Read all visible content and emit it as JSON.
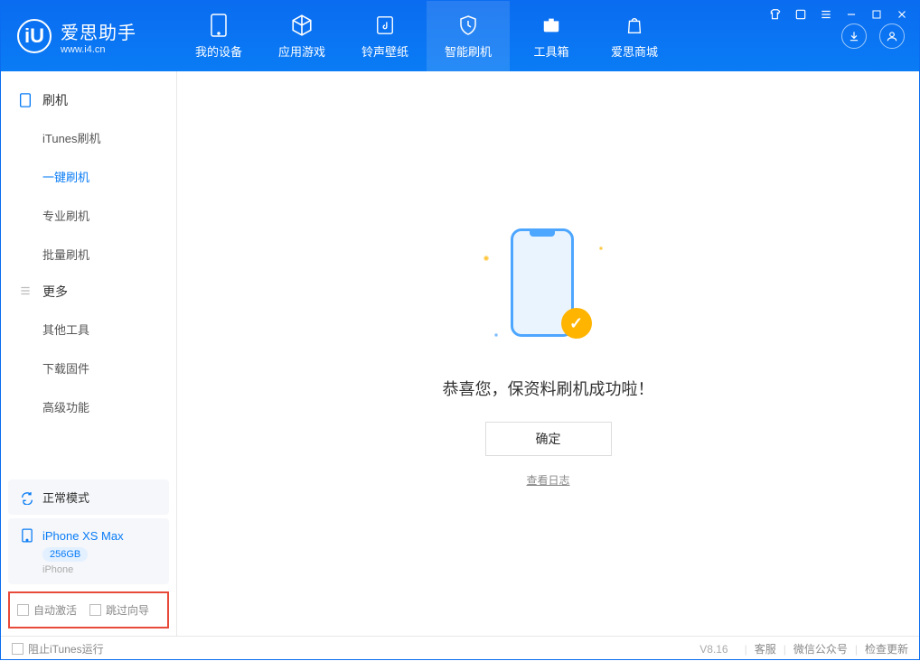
{
  "app": {
    "title": "爱思助手",
    "subtitle": "www.i4.cn",
    "logo_letter": "iU"
  },
  "tabs": [
    {
      "label": "我的设备"
    },
    {
      "label": "应用游戏"
    },
    {
      "label": "铃声壁纸"
    },
    {
      "label": "智能刷机"
    },
    {
      "label": "工具箱"
    },
    {
      "label": "爱思商城"
    }
  ],
  "sidebar": {
    "section1": "刷机",
    "items1": [
      "iTunes刷机",
      "一键刷机",
      "专业刷机",
      "批量刷机"
    ],
    "section2": "更多",
    "items2": [
      "其他工具",
      "下载固件",
      "高级功能"
    ]
  },
  "mode": {
    "label": "正常模式"
  },
  "device": {
    "name": "iPhone XS Max",
    "storage": "256GB",
    "type": "iPhone"
  },
  "checkboxes": {
    "auto_activate": "自动激活",
    "skip_guide": "跳过向导"
  },
  "main": {
    "success": "恭喜您，保资料刷机成功啦！",
    "confirm": "确定",
    "log": "查看日志"
  },
  "footer": {
    "block_itunes": "阻止iTunes运行",
    "version": "V8.16",
    "links": [
      "客服",
      "微信公众号",
      "检查更新"
    ]
  }
}
